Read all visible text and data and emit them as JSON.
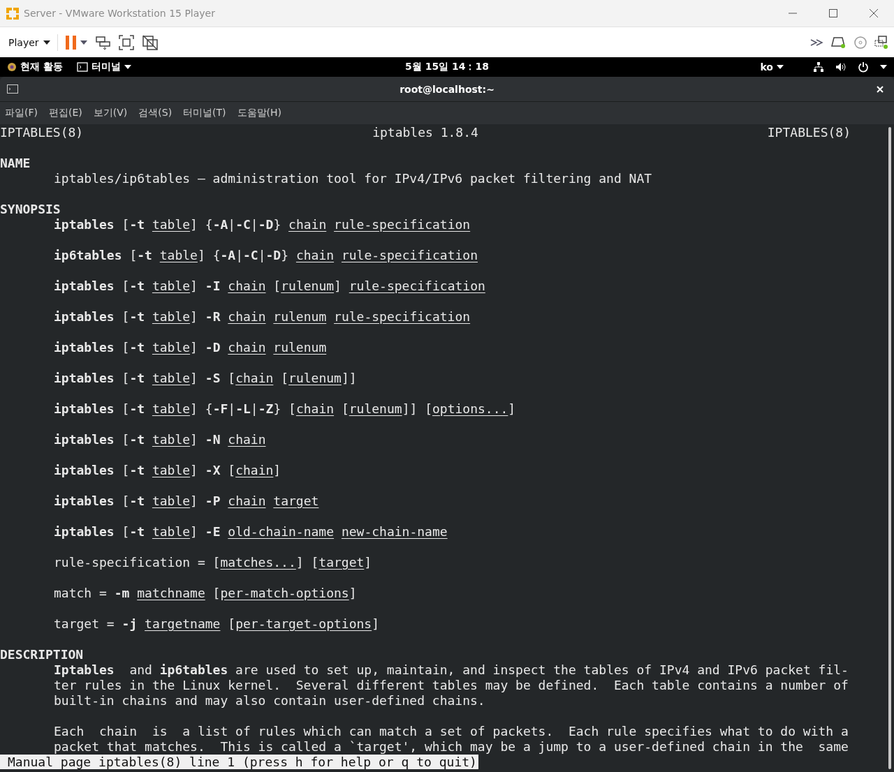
{
  "window": {
    "title": "Server - VMware Workstation 15 Player"
  },
  "toolbar": {
    "menu": "Player"
  },
  "top_bar": {
    "activities": "현재 활동",
    "app": "터미널",
    "clock": "5월 15일  14：18",
    "language": "ko"
  },
  "terminal": {
    "title": "root@localhost:~",
    "menu": [
      "파일(F)",
      "편집(E)",
      "보기(V)",
      "검색(S)",
      "터미널(T)",
      "도움말(H)"
    ],
    "header": {
      "left": "IPTABLES(8)",
      "center": "iptables 1.8.4",
      "right": "IPTABLES(8)"
    },
    "sections": [
      {
        "heading": "NAME",
        "paragraphs": [
          [
            "iptables/ip6tables — administration tool for IPv4/IPv6 packet filtering and NAT"
          ]
        ]
      },
      {
        "heading": "SYNOPSIS",
        "paragraphs": [
          [
            "**iptables** [**-t** *table*] {**-A**|**-C**|**-D**} *chain* *rule-specification*"
          ],
          [
            "**ip6tables** [**-t** *table*] {**-A**|**-C**|**-D**} *chain* *rule-specification*"
          ],
          [
            "**iptables** [**-t** *table*] **-I** *chain* [*rulenum*] *rule-specification*"
          ],
          [
            "**iptables** [**-t** *table*] **-R** *chain* *rulenum* *rule-specification*"
          ],
          [
            "**iptables** [**-t** *table*] **-D** *chain* *rulenum*"
          ],
          [
            "**iptables** [**-t** *table*] **-S** [*chain* [*rulenum*]]"
          ],
          [
            "**iptables** [**-t** *table*] {**-F**|**-L**|**-Z**} [*chain* [*rulenum*]] [*options...*]"
          ],
          [
            "**iptables** [**-t** *table*] **-N** *chain*"
          ],
          [
            "**iptables** [**-t** *table*] **-X** [*chain*]"
          ],
          [
            "**iptables** [**-t** *table*] **-P** *chain* *target*"
          ],
          [
            "**iptables** [**-t** *table*] **-E** *old-chain-name* *new-chain-name*"
          ],
          [
            "rule-specification = [*matches...*] [*target*]"
          ],
          [
            "match = **-m** *matchname* [*per-match-options*]"
          ],
          [
            "target = **-j** *targetname* [*per-target-options*]"
          ]
        ]
      },
      {
        "heading": "DESCRIPTION",
        "paragraphs": [
          [
            "**Iptables**  and **ip6tables** are used to set up, maintain, and inspect the tables of IPv4 and IPv6 packet fil‐",
            "ter rules in the Linux kernel.  Several different tables may be defined.  Each table contains a number of",
            "built-in chains and may also contain user-defined chains."
          ],
          [
            "Each  chain  is  a list of rules which can match a set of packets.  Each rule specifies what to do with a",
            "packet that matches.  This is called a `target', which may be a jump to a user-defined chain in the  same"
          ]
        ]
      }
    ],
    "status": "Manual page iptables(8) line 1 (press h for help or q to quit)"
  }
}
